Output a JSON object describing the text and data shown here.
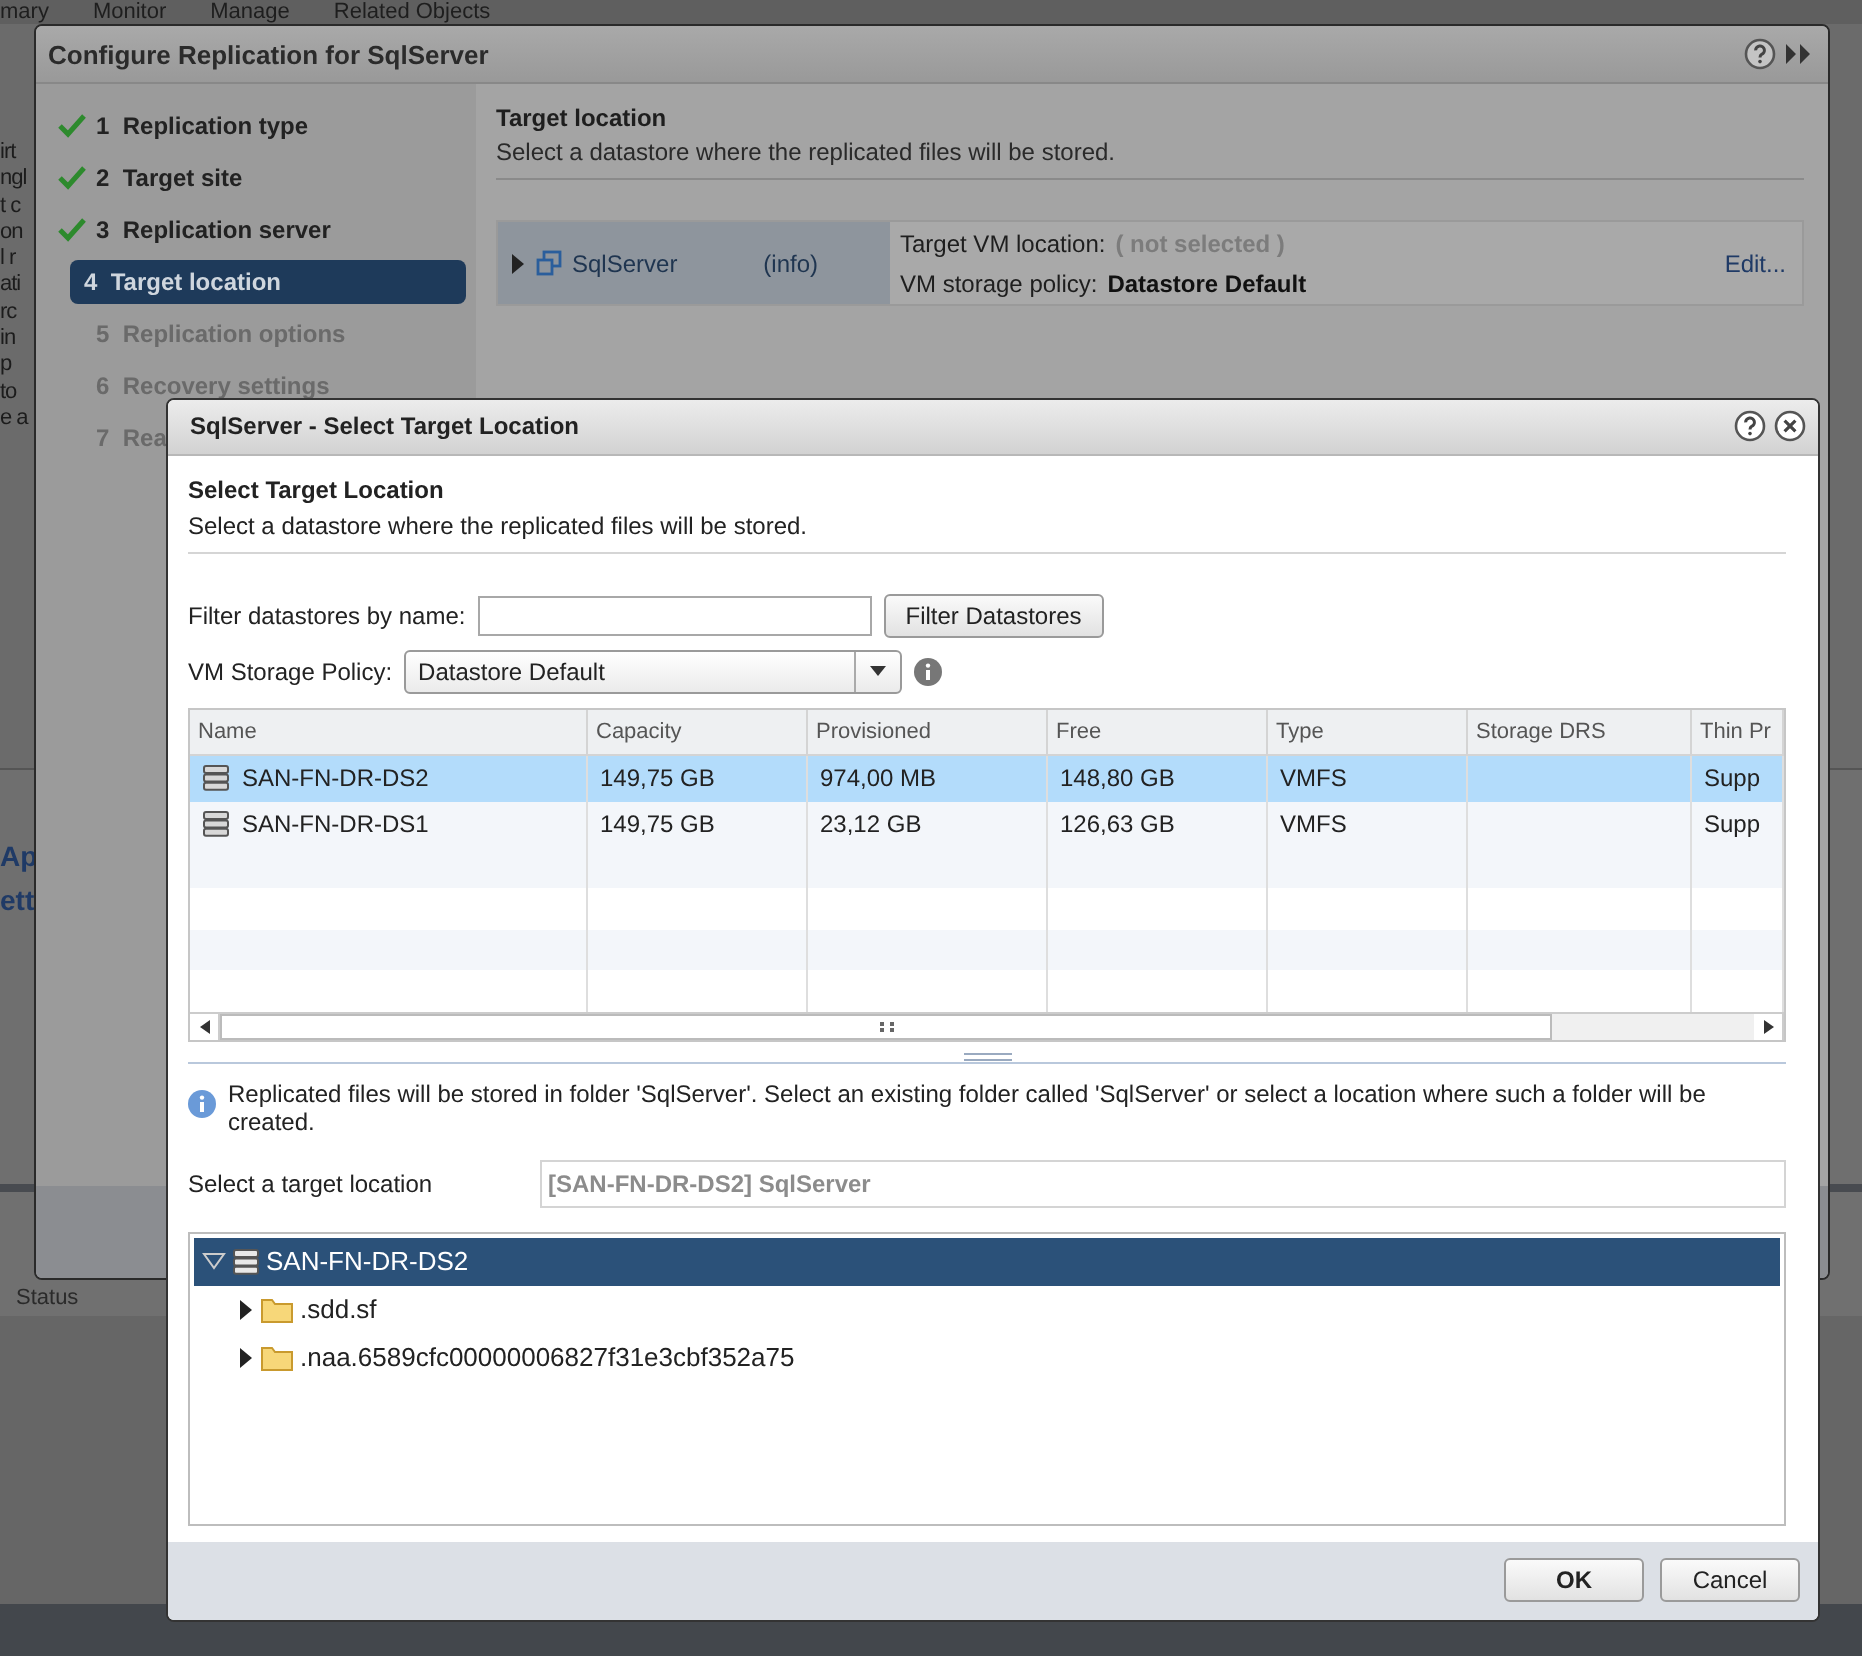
{
  "background": {
    "menu_tabs": [
      "mary",
      "Monitor",
      "Manage",
      "Related Objects"
    ],
    "text_fragments": [
      "irt",
      "ngl",
      "t c",
      "on",
      "l r",
      "ati",
      "rc",
      "in",
      "p",
      "to",
      "e a"
    ],
    "links": [
      "Ap",
      "ett"
    ],
    "status_header": "Status"
  },
  "wizard": {
    "title": "Configure Replication for SqlServer",
    "steps": [
      {
        "number": "1",
        "label": "Replication type",
        "done": true,
        "selected": false
      },
      {
        "number": "2",
        "label": "Target site",
        "done": true,
        "selected": false
      },
      {
        "number": "3",
        "label": "Replication server",
        "done": true,
        "selected": false
      },
      {
        "number": "4",
        "label": "Target location",
        "done": false,
        "selected": true
      },
      {
        "number": "5",
        "label": "Replication options",
        "done": false,
        "selected": false
      },
      {
        "number": "6",
        "label": "Recovery settings",
        "done": false,
        "selected": false
      },
      {
        "number": "7",
        "label": "Rea",
        "done": false,
        "selected": false
      }
    ],
    "heading": "Target location",
    "description": "Select a datastore where the replicated files will be stored.",
    "vm": {
      "name": "SqlServer",
      "info": "(info)",
      "expanded": false,
      "location_label": "Target VM location:",
      "location_value": "( not selected )",
      "policy_label": "VM storage policy:",
      "policy_value": "Datastore Default",
      "edit": "Edit..."
    }
  },
  "dialog": {
    "title": "SqlServer - Select Target Location",
    "heading": "Select Target Location",
    "description": "Select a datastore where the replicated files will be stored.",
    "filter": {
      "label": "Filter datastores by name:",
      "button": "Filter Datastores"
    },
    "policy": {
      "label": "VM Storage Policy:",
      "value": "Datastore Default"
    },
    "table": {
      "columns": [
        "Name",
        "Capacity",
        "Provisioned",
        "Free",
        "Type",
        "Storage DRS",
        "Thin Pr"
      ],
      "rows": [
        {
          "cells": [
            "SAN-FN-DR-DS2",
            "149,75 GB",
            "974,00 MB",
            "148,80 GB",
            "VMFS",
            "",
            "Supp"
          ],
          "selected": true
        },
        {
          "cells": [
            "SAN-FN-DR-DS1",
            "149,75 GB",
            "23,12 GB",
            "126,63 GB",
            "VMFS",
            "",
            "Supp"
          ],
          "selected": false
        }
      ]
    },
    "info_message": "Replicated files will be stored in folder 'SqlServer'. Select an existing folder called 'SqlServer' or select a location where such a folder will be created.",
    "target": {
      "label": "Select a target location",
      "value": "[SAN-FN-DR-DS2] SqlServer"
    },
    "tree": [
      {
        "label": "SAN-FN-DR-DS2",
        "kind": "datastore",
        "expanded": true,
        "selected": true,
        "children": [
          {
            "label": ".sdd.sf",
            "kind": "folder",
            "expanded": false,
            "selected": false
          },
          {
            "label": ".naa.6589cfc00000006827f31e3cbf352a75",
            "kind": "folder",
            "expanded": false,
            "selected": false
          }
        ]
      }
    ],
    "buttons": [
      "OK",
      "Cancel"
    ]
  }
}
